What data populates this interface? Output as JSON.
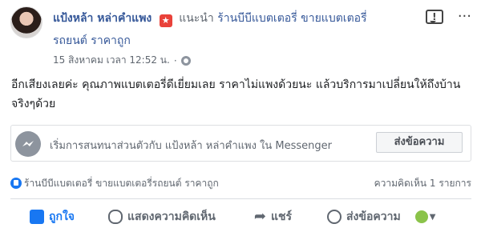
{
  "post": {
    "author": "แป้งหล้า หล่าคำแพง",
    "recommends": "แนะนำ",
    "page_name_line1": "ร้านบีบีแบตเตอรี่ ขายแบตเตอรี่",
    "page_name_line2": "รถยนต์ ราคาถูก",
    "timestamp": "15 สิงหาคม เวลา 12:52 น.",
    "separator": "·",
    "text": "อีกเสียงเลยค่ะ คุณภาพแบตเตอรี่ดีเยี่ยมเลย ราคาไม่แพงด้วยนะ แล้วบริการมาเปลี่ยนให้ถึงบ้านจริงๆด้วย"
  },
  "messenger": {
    "prompt": "เริ่มการสนทนาส่วนตัวกับ แป้งหล้า หล่าคำแพง ใน Messenger",
    "button": "ส่งข้อความ"
  },
  "summary": {
    "page": "ร้านบีบีแบตเตอรี่ ขายแบตเตอรี่รถยนต์ ราคาถูก",
    "comments": "ความคิดเห็น 1 รายการ"
  },
  "actions": {
    "like": "ถูกใจ",
    "comment": "แสดงความคิดเห็น",
    "share": "แชร์",
    "message": "ส่งข้อความ"
  },
  "icons": {
    "badge": "star-badge-icon",
    "report": "report-icon",
    "more": "more-icon",
    "globe": "globe-icon",
    "messenger": "messenger-icon",
    "like": "thumbs-up-icon",
    "comment": "comment-icon",
    "share": "share-icon",
    "message": "message-icon",
    "audience": "audience-icon"
  },
  "colors": {
    "link": "#365899",
    "like_blue": "#1877f2",
    "muted": "#606770"
  }
}
